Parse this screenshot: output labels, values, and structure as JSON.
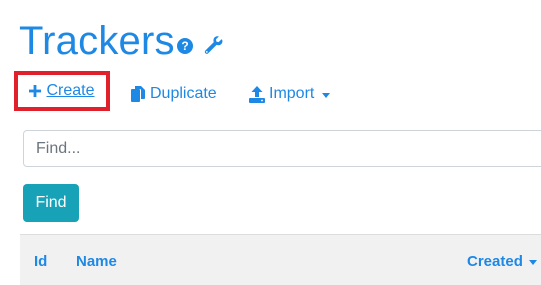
{
  "page": {
    "title": "Trackers"
  },
  "icons": {
    "help": "question-circle-icon",
    "settings": "wrench-icon",
    "create": "plus-icon",
    "duplicate": "copy-icon",
    "import": "upload-icon",
    "dropdown": "caret-down-icon"
  },
  "toolbar": {
    "create_label": "Create",
    "duplicate_label": "Duplicate",
    "import_label": "Import"
  },
  "search": {
    "placeholder": "Find...",
    "value": "",
    "button_label": "Find"
  },
  "table": {
    "columns": [
      {
        "label": "Id"
      },
      {
        "label": "Name"
      },
      {
        "label": "Created",
        "sorted": "desc"
      }
    ]
  },
  "colors": {
    "link": "#1e88e5",
    "find_button": "#17a2b8",
    "highlight": "#e0202a"
  }
}
